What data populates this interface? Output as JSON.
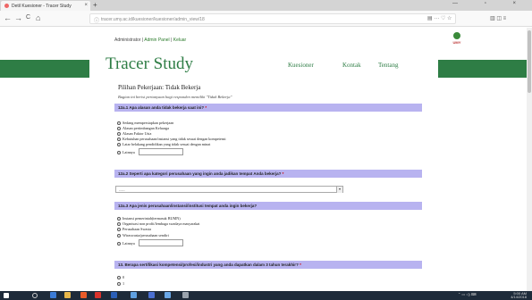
{
  "browser": {
    "tab_title": "Detil Kuesioner - Tracer Study",
    "tab_close": "×",
    "new_tab": "+",
    "url": "tracer.umy.ac.id/kuesioner/kuesioner/admin_view/18",
    "back": "←",
    "forward": "→",
    "reload": "C",
    "home": "⌂",
    "win_controls": "— ▫ ×",
    "url_icons": "▤ ··· ♡ ☆",
    "right_icons": "▥ ◫ ≡"
  },
  "admin": {
    "user": "Administrator",
    "sep1": "|",
    "link1": "Admin Panel",
    "sep2": "|",
    "link2": "Keluar",
    "logo_text": "UMY"
  },
  "header": {
    "brand": "Tracer Study",
    "menu": [
      "Kuesioner",
      "Kontak",
      "Tentang"
    ]
  },
  "page": {
    "title": "Pilihan Pekerjaan: Tidak Bekerja",
    "subtitle": "Bagian ini berisi pertanyaan bagi responden memiliki \"Tidak Bekerja\""
  },
  "questions": [
    {
      "label": "12a.1 Apa alasan anda tidak bekerja saat ini?",
      "req": "*",
      "options": [
        "Sedang mempersiapkan pekerjaan",
        "Alasan pertimbangan Keluarga",
        "Alasan Faktor Usia",
        "Kebutuhan perusahaan/instansi yang tidak sesuai dengan kompetensi",
        "Latar belakang pendidikan yang tidak sesuai dengan minat",
        "Lainnya"
      ]
    },
    {
      "label": "12a.2 Seperti apa kategori perusahaan yang ingin anda jadikan tempat Anda bekerja?",
      "req": "*",
      "select_value": "-----",
      "select_arrow": "▾"
    },
    {
      "label": "12a.3 Apa jenis perusahaan/instansi/institusi tempat anda ingin bekerja?",
      "req": "",
      "options": [
        "Instansi pemerintah(termasuk BUMN)",
        "Organisasi non profit/lembaga swadaya masyarakat",
        "Perusahaan Swasta",
        "Wiraswasta/perusahaan sendiri",
        "Lainnya"
      ]
    },
    {
      "label": "13. Berapa sertifikasi kompetensi/profesi/industri yang anda dapatkan dalam 3 tahun terakhir?",
      "req": "*",
      "options": [
        "0",
        "1"
      ]
    }
  ],
  "taskbar": {
    "time": "5:00 AM",
    "date": "4/14/2018",
    "tray_icons": "⌃ ▭ ◁) ⌨"
  },
  "colors": {
    "brand_green": "#2e7d45",
    "question_bar": "#b8b3f0",
    "taskbar": "#1e2b3a"
  }
}
